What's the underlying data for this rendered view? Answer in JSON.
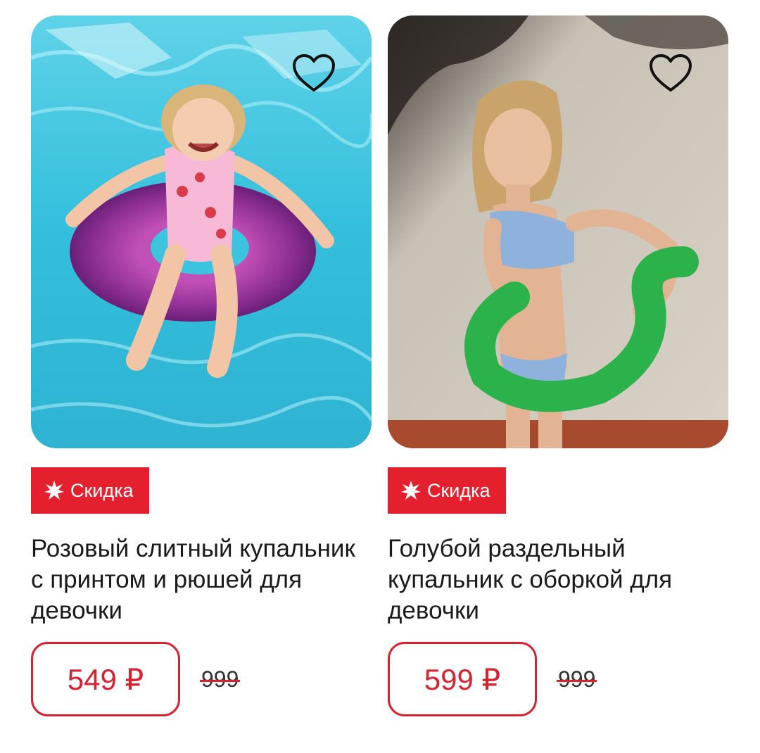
{
  "colors": {
    "accent": "#e5202e",
    "price_border": "#d8222f",
    "text": "#1a1a1a"
  },
  "products": [
    {
      "badge": "Скидка",
      "badge_icon": "burst-icon",
      "title": "Розовый слитный купальник с принтом и рюшей для девочки",
      "price": "549 ₽",
      "old_price": "999",
      "favorite_icon": "heart-outline-icon"
    },
    {
      "badge": "Скидка",
      "badge_icon": "burst-icon",
      "title": "Голубой раздельный купальник с оборкой для девочки",
      "price": "599 ₽",
      "old_price": "999",
      "favorite_icon": "heart-outline-icon"
    }
  ]
}
